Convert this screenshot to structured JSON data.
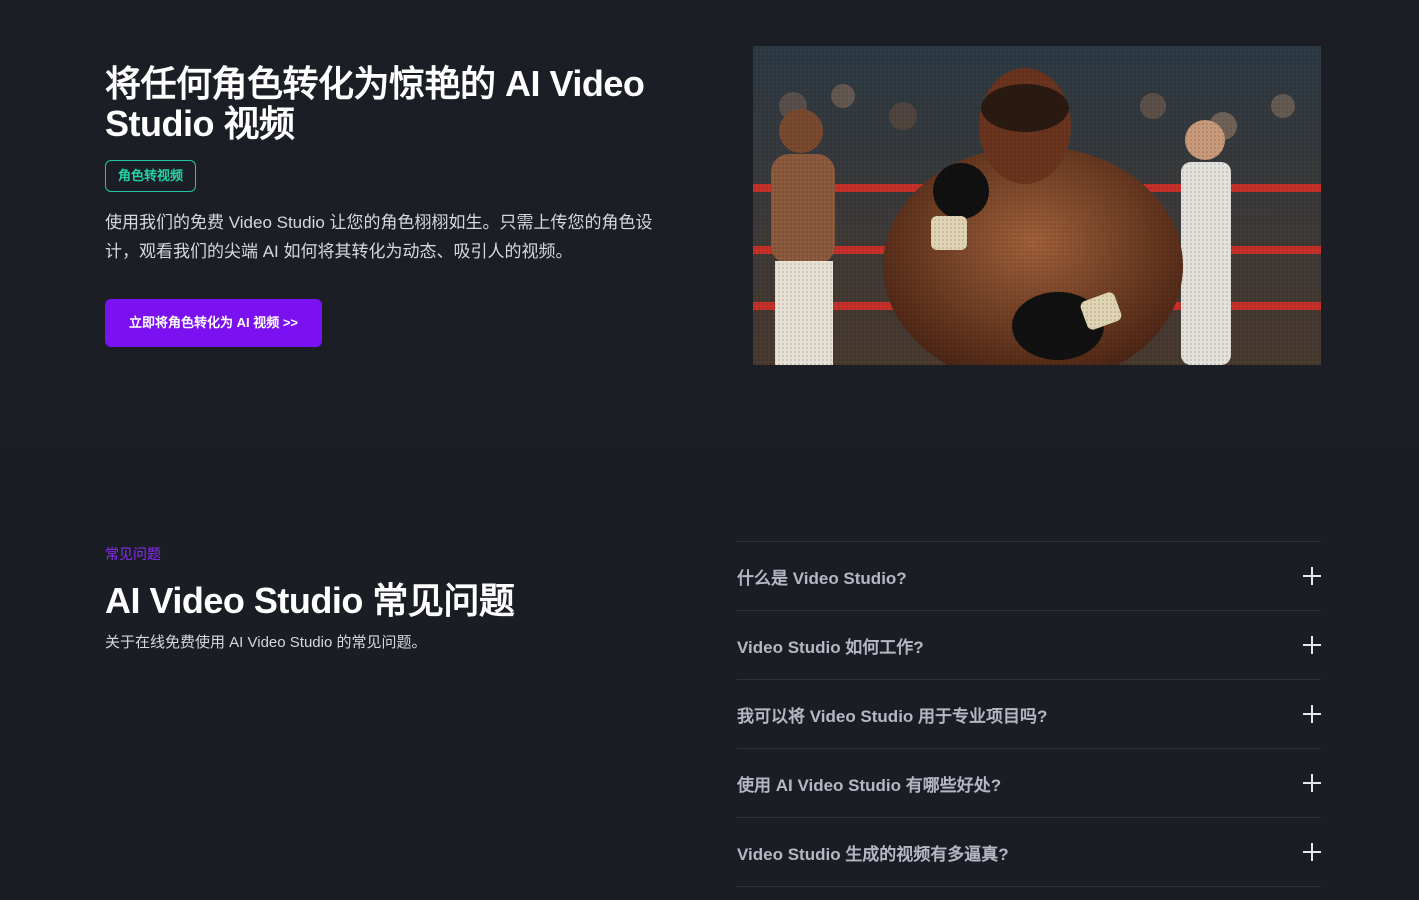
{
  "hero": {
    "title": "将任何角色转化为惊艳的 AI Video Studio 视频",
    "tag": "角色转视频",
    "description": "使用我们的免费 Video Studio 让您的角色栩栩如生。只需上传您的角色设计，观看我们的尖端 AI 如何将其转化为动态、吸引人的视频。",
    "cta_label": "立即将角色转化为 AI 视频 >>",
    "image_alt": "boxer-in-ring-photo"
  },
  "faq": {
    "eyebrow": "常见问题",
    "title": "AI Video Studio 常见问题",
    "subtitle": "关于在线免费使用 AI Video Studio 的常见问题。",
    "items": [
      {
        "question": "什么是 Video Studio?"
      },
      {
        "question": "Video Studio 如何工作?"
      },
      {
        "question": "我可以将 Video Studio 用于专业项目吗?"
      },
      {
        "question": "使用 AI Video Studio 有哪些好处?"
      },
      {
        "question": "Video Studio 生成的视频有多逼真?"
      }
    ]
  },
  "colors": {
    "background": "#1a1d24",
    "accent_purple": "#7b10f0",
    "tag_teal": "#22d3a6"
  }
}
